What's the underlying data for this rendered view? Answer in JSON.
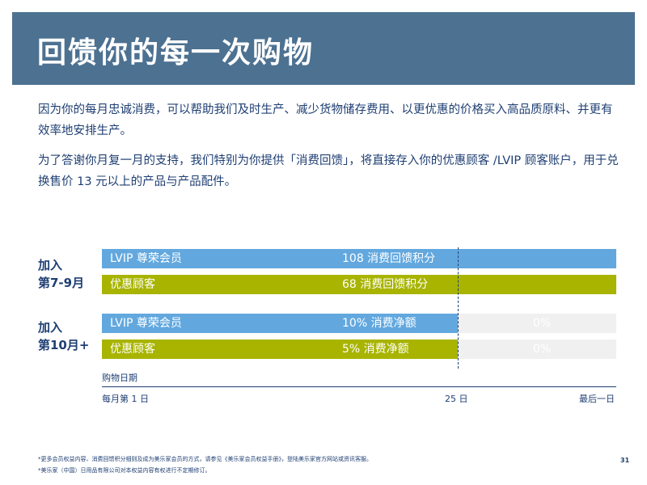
{
  "header": {
    "title": "回馈你的每一次购物"
  },
  "intro": {
    "paragraph1": "因为你的每月忠诚消费，可以帮助我们及时生产、减少货物储存费用、以更优惠的价格买入高品质原料、并更有效率地安排生产。",
    "paragraph2": "为了答谢你月复一月的支持，我们特别为你提供「消费回馈」，将直接存入你的优惠顾客 /LVIP 顾客账户，用于兑换售价 13 元以上的产品与产品配件。"
  },
  "groups": [
    {
      "label_line1": "加入",
      "label_line2": "第7-9月",
      "rows": [
        {
          "tier": "LVIP 尊荣会员",
          "reward": "108 消费回馈积分",
          "after_25th": ""
        },
        {
          "tier": "优惠顾客",
          "reward": "68 消费回馈积分",
          "after_25th": ""
        }
      ]
    },
    {
      "label_line1": "加入",
      "label_line2": "第10月+",
      "rows": [
        {
          "tier": "LVIP 尊荣会员",
          "reward": "10% 消费净额",
          "after_25th": "0%"
        },
        {
          "tier": "优惠顾客",
          "reward": "5%  消费净额",
          "after_25th": "0%"
        }
      ]
    }
  ],
  "axis": {
    "title": "购物日期",
    "start": "每月第 1 日",
    "mid": "25 日",
    "end": "最后一日"
  },
  "colors": {
    "header_bg": "#4d7191",
    "lvip_bar": "#62a8df",
    "preferred_bar": "#a8b400",
    "after_cutoff_bg": "#f0f0f0",
    "text": "#1f3f73"
  },
  "footnotes": {
    "note1": "*更多会员权益内容、消费回馈积分细则及成为美乐家会员的方式，请参见《美乐家会员权益手册》，登陆美乐家官方网站或资讯客服。",
    "note2": "*美乐家（中国）日用品有限公司对本权益内容有权进行不定期修订。"
  },
  "page_number": "31"
}
